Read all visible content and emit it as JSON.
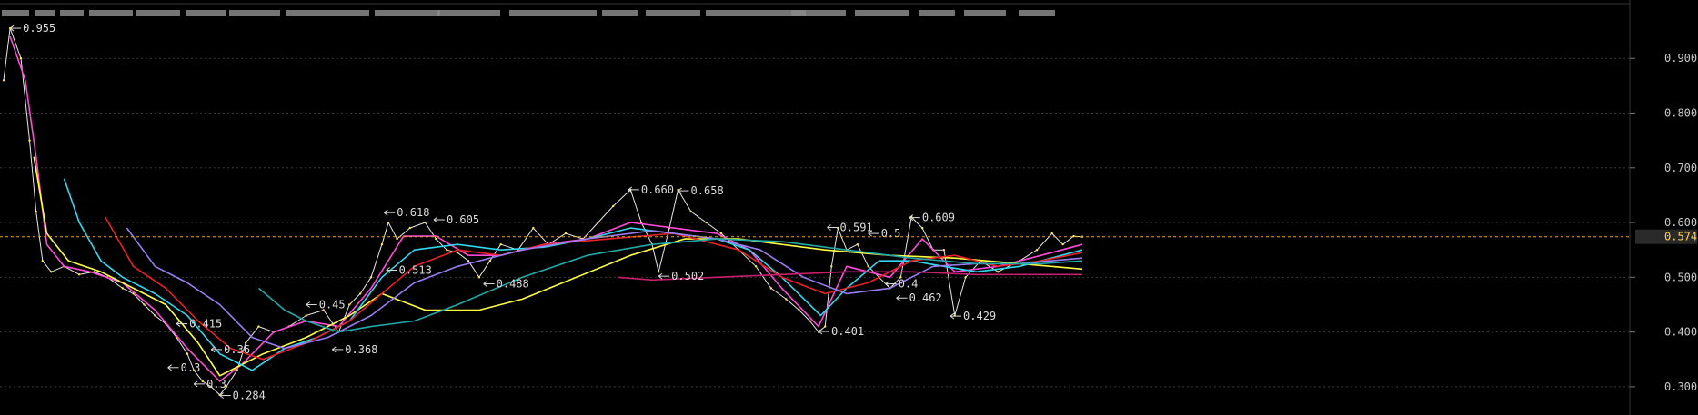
{
  "chart_data": {
    "type": "line",
    "title": "",
    "xlabel": "",
    "ylabel": "",
    "ylim": [
      0.26,
      0.97
    ],
    "y_ticks": [
      "0.900",
      "0.800",
      "0.700",
      "0.600",
      "0.500",
      "0.400",
      "0.300"
    ],
    "y_tick_values": [
      0.9,
      0.8,
      0.7,
      0.6,
      0.5,
      0.4,
      0.3
    ],
    "current_price": "0.574",
    "current_price_value": 0.574,
    "grid": true,
    "legend": "none",
    "x_range": [
      0,
      499
    ],
    "series": [
      {
        "color": "#e8e8e8",
        "points": [
          [
            0,
            0.86
          ],
          [
            3,
            0.955
          ],
          [
            8,
            0.9
          ],
          [
            12,
            0.75
          ],
          [
            15,
            0.62
          ],
          [
            18,
            0.53
          ],
          [
            22,
            0.51
          ],
          [
            28,
            0.52
          ],
          [
            35,
            0.505
          ],
          [
            42,
            0.51
          ],
          [
            48,
            0.5
          ],
          [
            55,
            0.48
          ],
          [
            60,
            0.47
          ],
          [
            65,
            0.45
          ],
          [
            70,
            0.43
          ],
          [
            75,
            0.415
          ],
          [
            80,
            0.39
          ],
          [
            85,
            0.36
          ],
          [
            88,
            0.33
          ],
          [
            92,
            0.31
          ],
          [
            96,
            0.3
          ],
          [
            100,
            0.285
          ],
          [
            103,
            0.3
          ],
          [
            108,
            0.33
          ],
          [
            112,
            0.38
          ],
          [
            118,
            0.41
          ],
          [
            125,
            0.4
          ],
          [
            132,
            0.41
          ],
          [
            140,
            0.43
          ],
          [
            148,
            0.44
          ],
          [
            155,
            0.4
          ],
          [
            160,
            0.45
          ],
          [
            165,
            0.47
          ],
          [
            170,
            0.5
          ],
          [
            175,
            0.56
          ],
          [
            178,
            0.6
          ],
          [
            182,
            0.57
          ],
          [
            188,
            0.59
          ],
          [
            195,
            0.6
          ],
          [
            200,
            0.57
          ],
          [
            205,
            0.55
          ],
          [
            210,
            0.545
          ],
          [
            215,
            0.53
          ],
          [
            220,
            0.5
          ],
          [
            225,
            0.53
          ],
          [
            230,
            0.56
          ],
          [
            238,
            0.55
          ],
          [
            245,
            0.59
          ],
          [
            252,
            0.56
          ],
          [
            260,
            0.58
          ],
          [
            268,
            0.57
          ],
          [
            275,
            0.6
          ],
          [
            282,
            0.63
          ],
          [
            290,
            0.66
          ],
          [
            295,
            0.6
          ],
          [
            300,
            0.56
          ],
          [
            303,
            0.51
          ],
          [
            308,
            0.59
          ],
          [
            312,
            0.66
          ],
          [
            318,
            0.62
          ],
          [
            325,
            0.6
          ],
          [
            332,
            0.58
          ],
          [
            340,
            0.55
          ],
          [
            348,
            0.52
          ],
          [
            355,
            0.48
          ],
          [
            362,
            0.46
          ],
          [
            368,
            0.44
          ],
          [
            373,
            0.42
          ],
          [
            377,
            0.4
          ],
          [
            380,
            0.41
          ],
          [
            383,
            0.52
          ],
          [
            386,
            0.59
          ],
          [
            390,
            0.55
          ],
          [
            395,
            0.56
          ],
          [
            400,
            0.52
          ],
          [
            405,
            0.5
          ],
          [
            410,
            0.48
          ],
          [
            415,
            0.5
          ],
          [
            420,
            0.61
          ],
          [
            425,
            0.59
          ],
          [
            430,
            0.55
          ],
          [
            435,
            0.55
          ],
          [
            440,
            0.43
          ],
          [
            445,
            0.5
          ],
          [
            452,
            0.53
          ],
          [
            460,
            0.51
          ],
          [
            470,
            0.53
          ],
          [
            478,
            0.55
          ],
          [
            485,
            0.58
          ],
          [
            490,
            0.56
          ],
          [
            495,
            0.575
          ],
          [
            499,
            0.574
          ]
        ]
      },
      {
        "color": "#ff4ad8",
        "points": [
          [
            3,
            0.94
          ],
          [
            10,
            0.86
          ],
          [
            15,
            0.72
          ],
          [
            20,
            0.56
          ],
          [
            28,
            0.52
          ],
          [
            40,
            0.51
          ],
          [
            55,
            0.49
          ],
          [
            70,
            0.44
          ],
          [
            85,
            0.37
          ],
          [
            100,
            0.31
          ],
          [
            110,
            0.34
          ],
          [
            125,
            0.4
          ],
          [
            140,
            0.42
          ],
          [
            155,
            0.41
          ],
          [
            170,
            0.48
          ],
          [
            185,
            0.575
          ],
          [
            200,
            0.575
          ],
          [
            215,
            0.54
          ],
          [
            230,
            0.54
          ],
          [
            250,
            0.56
          ],
          [
            270,
            0.57
          ],
          [
            290,
            0.6
          ],
          [
            310,
            0.59
          ],
          [
            330,
            0.58
          ],
          [
            345,
            0.55
          ],
          [
            360,
            0.48
          ],
          [
            377,
            0.41
          ],
          [
            390,
            0.52
          ],
          [
            410,
            0.5
          ],
          [
            425,
            0.57
          ],
          [
            440,
            0.51
          ],
          [
            460,
            0.52
          ],
          [
            480,
            0.54
          ],
          [
            499,
            0.56
          ]
        ]
      },
      {
        "color": "#ffff40",
        "points": [
          [
            14,
            0.72
          ],
          [
            20,
            0.58
          ],
          [
            30,
            0.53
          ],
          [
            45,
            0.51
          ],
          [
            60,
            0.48
          ],
          [
            75,
            0.45
          ],
          [
            90,
            0.38
          ],
          [
            100,
            0.32
          ],
          [
            120,
            0.36
          ],
          [
            140,
            0.39
          ],
          [
            160,
            0.43
          ],
          [
            175,
            0.47
          ],
          [
            195,
            0.44
          ],
          [
            220,
            0.44
          ],
          [
            240,
            0.46
          ],
          [
            265,
            0.5
          ],
          [
            290,
            0.54
          ],
          [
            315,
            0.57
          ],
          [
            340,
            0.57
          ],
          [
            360,
            0.56
          ],
          [
            380,
            0.55
          ],
          [
            410,
            0.54
          ],
          [
            440,
            0.535
          ],
          [
            470,
            0.525
          ],
          [
            499,
            0.515
          ]
        ]
      },
      {
        "color": "#30d8f0",
        "points": [
          [
            28,
            0.68
          ],
          [
            35,
            0.6
          ],
          [
            45,
            0.53
          ],
          [
            55,
            0.5
          ],
          [
            70,
            0.47
          ],
          [
            85,
            0.43
          ],
          [
            100,
            0.36
          ],
          [
            115,
            0.33
          ],
          [
            130,
            0.37
          ],
          [
            145,
            0.39
          ],
          [
            160,
            0.42
          ],
          [
            175,
            0.5
          ],
          [
            190,
            0.55
          ],
          [
            210,
            0.56
          ],
          [
            230,
            0.55
          ],
          [
            250,
            0.555
          ],
          [
            270,
            0.57
          ],
          [
            290,
            0.59
          ],
          [
            310,
            0.58
          ],
          [
            330,
            0.57
          ],
          [
            345,
            0.55
          ],
          [
            360,
            0.5
          ],
          [
            378,
            0.43
          ],
          [
            390,
            0.48
          ],
          [
            405,
            0.53
          ],
          [
            420,
            0.53
          ],
          [
            435,
            0.52
          ],
          [
            450,
            0.51
          ],
          [
            470,
            0.52
          ],
          [
            499,
            0.55
          ]
        ]
      },
      {
        "color": "#e8202a",
        "points": [
          [
            47,
            0.61
          ],
          [
            60,
            0.52
          ],
          [
            75,
            0.48
          ],
          [
            90,
            0.42
          ],
          [
            105,
            0.37
          ],
          [
            120,
            0.35
          ],
          [
            140,
            0.38
          ],
          [
            160,
            0.42
          ],
          [
            175,
            0.47
          ],
          [
            190,
            0.52
          ],
          [
            210,
            0.55
          ],
          [
            230,
            0.54
          ],
          [
            250,
            0.56
          ],
          [
            280,
            0.57
          ],
          [
            310,
            0.58
          ],
          [
            340,
            0.55
          ],
          [
            360,
            0.5
          ],
          [
            380,
            0.47
          ],
          [
            400,
            0.49
          ],
          [
            420,
            0.53
          ],
          [
            440,
            0.54
          ],
          [
            460,
            0.52
          ],
          [
            480,
            0.53
          ],
          [
            499,
            0.545
          ]
        ]
      },
      {
        "color": "#9a7cf0",
        "points": [
          [
            57,
            0.59
          ],
          [
            70,
            0.52
          ],
          [
            85,
            0.49
          ],
          [
            100,
            0.45
          ],
          [
            115,
            0.39
          ],
          [
            130,
            0.37
          ],
          [
            150,
            0.39
          ],
          [
            170,
            0.43
          ],
          [
            190,
            0.49
          ],
          [
            210,
            0.52
          ],
          [
            240,
            0.55
          ],
          [
            270,
            0.57
          ],
          [
            300,
            0.585
          ],
          [
            330,
            0.57
          ],
          [
            350,
            0.55
          ],
          [
            370,
            0.5
          ],
          [
            390,
            0.47
          ],
          [
            410,
            0.48
          ],
          [
            430,
            0.52
          ],
          [
            450,
            0.525
          ],
          [
            470,
            0.525
          ],
          [
            499,
            0.535
          ]
        ]
      },
      {
        "color": "#20a8a8",
        "points": [
          [
            118,
            0.48
          ],
          [
            130,
            0.44
          ],
          [
            140,
            0.42
          ],
          [
            155,
            0.4
          ],
          [
            170,
            0.41
          ],
          [
            190,
            0.42
          ],
          [
            210,
            0.45
          ],
          [
            240,
            0.5
          ],
          [
            270,
            0.54
          ],
          [
            300,
            0.56
          ],
          [
            330,
            0.57
          ],
          [
            360,
            0.565
          ],
          [
            390,
            0.55
          ],
          [
            420,
            0.535
          ],
          [
            450,
            0.525
          ],
          [
            480,
            0.525
          ],
          [
            499,
            0.53
          ]
        ]
      },
      {
        "color": "#c81e6e",
        "points": [
          [
            284,
            0.5
          ],
          [
            300,
            0.495
          ],
          [
            330,
            0.5
          ],
          [
            360,
            0.505
          ],
          [
            390,
            0.51
          ],
          [
            420,
            0.51
          ],
          [
            450,
            0.505
          ],
          [
            480,
            0.505
          ],
          [
            499,
            0.505
          ]
        ]
      }
    ],
    "annotations": [
      {
        "text": "0.955",
        "x": 3,
        "y": 0.955,
        "dir": "right"
      },
      {
        "text": "0.618",
        "x": 176,
        "y": 0.618,
        "dir": "right"
      },
      {
        "text": "0.605",
        "x": 199,
        "y": 0.605,
        "dir": "right"
      },
      {
        "text": "0.513",
        "x": 177,
        "y": 0.513,
        "dir": "right"
      },
      {
        "text": "0.488",
        "x": 222,
        "y": 0.488,
        "dir": "right"
      },
      {
        "text": "0.45",
        "x": 140,
        "y": 0.45,
        "dir": "right"
      },
      {
        "text": "0.415",
        "x": 80,
        "y": 0.415,
        "dir": "right"
      },
      {
        "text": "0.368",
        "x": 152,
        "y": 0.368,
        "dir": "right"
      },
      {
        "text": "0.36",
        "x": 96,
        "y": 0.368,
        "dir": "right"
      },
      {
        "text": "0.3",
        "x": 76,
        "y": 0.335,
        "dir": "right"
      },
      {
        "text": "0.3",
        "x": 88,
        "y": 0.305,
        "dir": "right"
      },
      {
        "text": "0.284",
        "x": 100,
        "y": 0.284,
        "dir": "right"
      },
      {
        "text": "0.660",
        "x": 289,
        "y": 0.66,
        "dir": "right"
      },
      {
        "text": "0.658",
        "x": 312,
        "y": 0.658,
        "dir": "right"
      },
      {
        "text": "0.502",
        "x": 303,
        "y": 0.502,
        "dir": "right"
      },
      {
        "text": "0.591",
        "x": 381,
        "y": 0.591,
        "dir": "right"
      },
      {
        "text": "0.5",
        "x": 400,
        "y": 0.58,
        "dir": "right"
      },
      {
        "text": "0.609",
        "x": 419,
        "y": 0.609,
        "dir": "right"
      },
      {
        "text": "0.4",
        "x": 408,
        "y": 0.488,
        "dir": "right"
      },
      {
        "text": "0.462",
        "x": 413,
        "y": 0.462,
        "dir": "right"
      },
      {
        "text": "0.429",
        "x": 438,
        "y": 0.429,
        "dir": "right"
      },
      {
        "text": "0.401",
        "x": 377,
        "y": 0.401,
        "dir": "right"
      }
    ]
  }
}
